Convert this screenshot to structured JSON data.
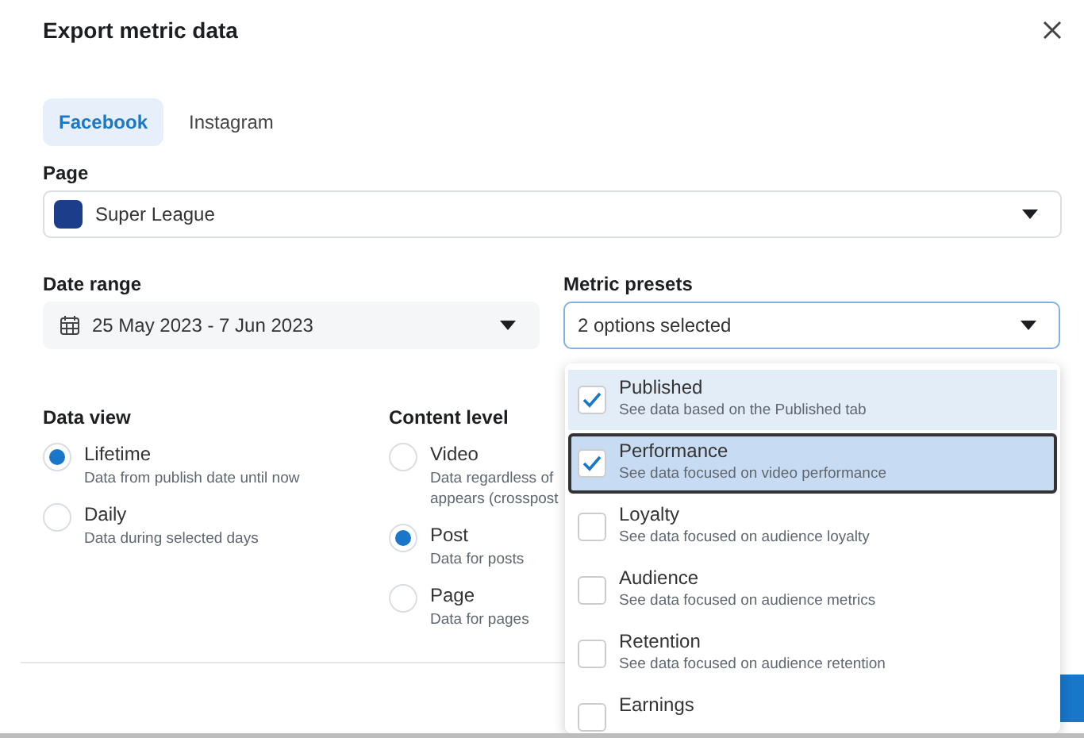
{
  "dialog": {
    "title": "Export metric data"
  },
  "tabs": [
    {
      "label": "Facebook",
      "selected": true
    },
    {
      "label": "Instagram",
      "selected": false
    }
  ],
  "page_field": {
    "label": "Page",
    "value": "Super League"
  },
  "date_range": {
    "label": "Date range",
    "value": "25 May 2023 - 7 Jun 2023"
  },
  "metric_presets": {
    "label": "Metric presets",
    "value": "2 options selected"
  },
  "data_view": {
    "label": "Data view",
    "options": [
      {
        "label": "Lifetime",
        "description": "Data from publish date until now",
        "selected": true
      },
      {
        "label": "Daily",
        "description": "Data during selected days",
        "selected": false
      }
    ]
  },
  "content_level": {
    "label": "Content level",
    "options": [
      {
        "label": "Video",
        "description": "Data regardless of appears (crosspost",
        "selected": false
      },
      {
        "label": "Post",
        "description": "Data for posts",
        "selected": true
      },
      {
        "label": "Page",
        "description": "Data for pages",
        "selected": false
      }
    ]
  },
  "preset_menu": [
    {
      "label": "Published",
      "description": "See data based on the Published tab",
      "checked": true,
      "focused": false
    },
    {
      "label": "Performance",
      "description": "See data focused on video performance",
      "checked": true,
      "focused": true
    },
    {
      "label": "Loyalty",
      "description": "See data focused on audience loyalty",
      "checked": false,
      "focused": false
    },
    {
      "label": "Audience",
      "description": "See data focused on audience metrics",
      "checked": false,
      "focused": false
    },
    {
      "label": "Retention",
      "description": "See data focused on audience retention",
      "checked": false,
      "focused": false
    },
    {
      "label": "Earnings",
      "checked": false,
      "focused": false
    }
  ]
}
